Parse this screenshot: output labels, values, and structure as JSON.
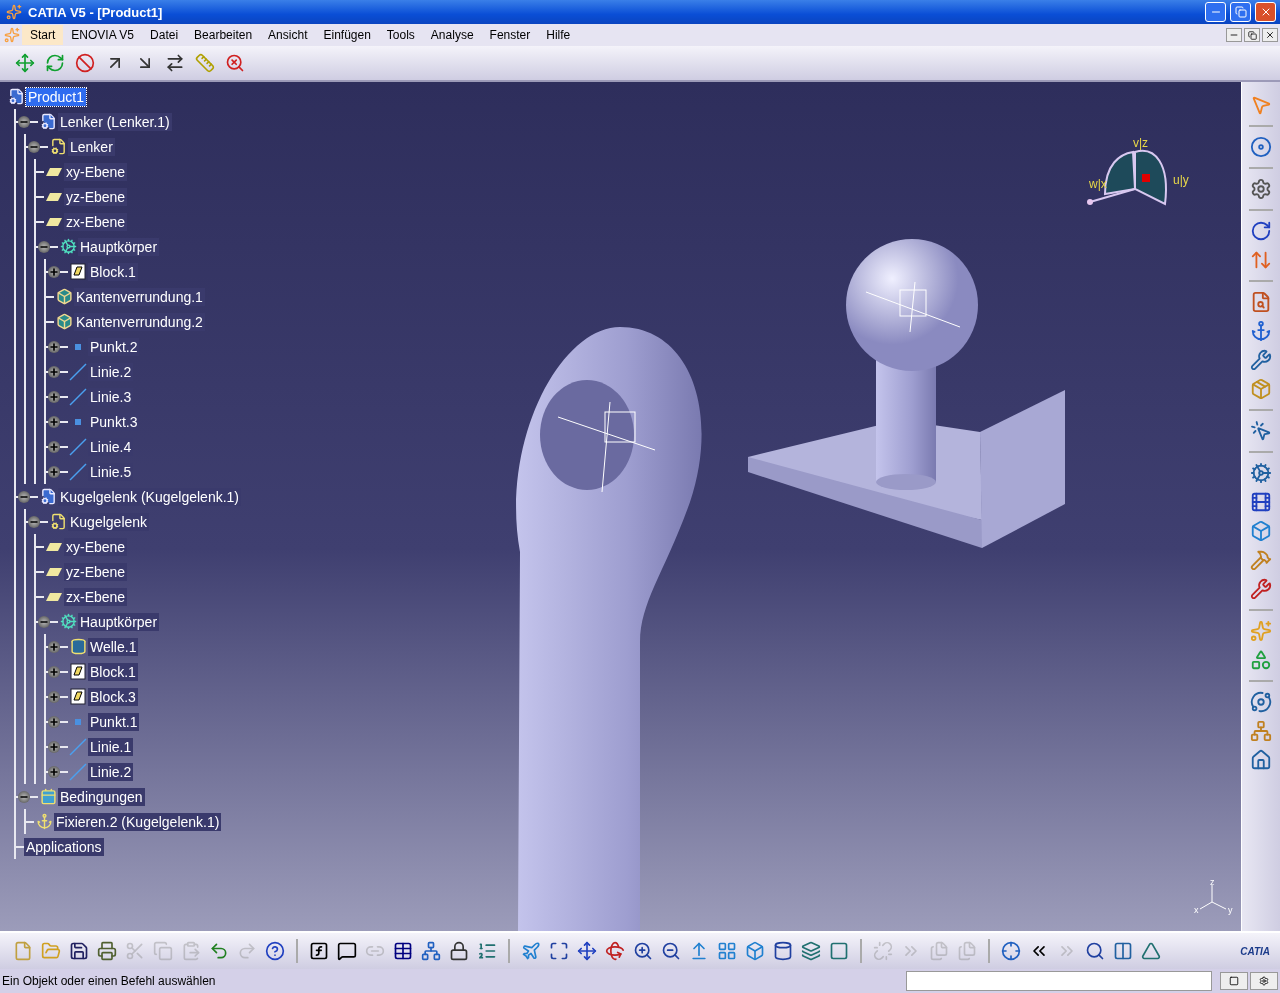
{
  "window": {
    "title": "CATIA V5 - [Product1]"
  },
  "menu": [
    {
      "label": "Start",
      "selected": true
    },
    {
      "label": "ENOVIA V5",
      "selected": false
    },
    {
      "label": "Datei",
      "selected": false
    },
    {
      "label": "Bearbeiten",
      "selected": false
    },
    {
      "label": "Ansicht",
      "selected": false
    },
    {
      "label": "Einfügen",
      "selected": false
    },
    {
      "label": "Tools",
      "selected": false
    },
    {
      "label": "Analyse",
      "selected": false
    },
    {
      "label": "Fenster",
      "selected": false
    },
    {
      "label": "Hilfe",
      "selected": false
    }
  ],
  "tree": [
    {
      "label": "Product1",
      "kind": "product",
      "selected": true,
      "children": [
        {
          "label": "Lenker (Lenker.1)",
          "kind": "instance",
          "selected": false,
          "expanded": true,
          "children": [
            {
              "label": "Lenker",
              "kind": "part",
              "selected": false,
              "expanded": true,
              "children": [
                {
                  "label": "xy-Ebene",
                  "kind": "plane",
                  "selected": false
                },
                {
                  "label": "yz-Ebene",
                  "kind": "plane",
                  "selected": false
                },
                {
                  "label": "zx-Ebene",
                  "kind": "plane",
                  "selected": false
                },
                {
                  "label": "Hauptkörper",
                  "kind": "body",
                  "selected": false,
                  "expanded": true,
                  "children": [
                    {
                      "label": "Block.1",
                      "kind": "block",
                      "selected": false,
                      "expanded": false
                    },
                    {
                      "label": "Kantenverrundung.1",
                      "kind": "fillet",
                      "selected": false
                    },
                    {
                      "label": "Kantenverrundung.2",
                      "kind": "fillet",
                      "selected": false
                    },
                    {
                      "label": "Punkt.2",
                      "kind": "point",
                      "selected": false,
                      "expanded": false
                    },
                    {
                      "label": "Linie.2",
                      "kind": "line",
                      "selected": false,
                      "expanded": false
                    },
                    {
                      "label": "Linie.3",
                      "kind": "line",
                      "selected": false,
                      "expanded": false
                    },
                    {
                      "label": "Punkt.3",
                      "kind": "point",
                      "selected": false,
                      "expanded": false
                    },
                    {
                      "label": "Linie.4",
                      "kind": "line",
                      "selected": false,
                      "expanded": false
                    },
                    {
                      "label": "Linie.5",
                      "kind": "line",
                      "selected": false,
                      "expanded": false
                    }
                  ]
                }
              ]
            }
          ]
        },
        {
          "label": "Kugelgelenk (Kugelgelenk.1)",
          "kind": "instance",
          "selected": false,
          "expanded": true,
          "children": [
            {
              "label": "Kugelgelenk",
              "kind": "part",
              "selected": false,
              "expanded": true,
              "children": [
                {
                  "label": "xy-Ebene",
                  "kind": "plane",
                  "selected": false
                },
                {
                  "label": "yz-Ebene",
                  "kind": "plane",
                  "selected": false
                },
                {
                  "label": "zx-Ebene",
                  "kind": "plane",
                  "selected": false
                },
                {
                  "label": "Hauptkörper",
                  "kind": "body",
                  "selected": false,
                  "expanded": true,
                  "children": [
                    {
                      "label": "Welle.1",
                      "kind": "shaft",
                      "selected": false,
                      "expanded": false
                    },
                    {
                      "label": "Block.1",
                      "kind": "block",
                      "selected": false,
                      "expanded": false
                    },
                    {
                      "label": "Block.3",
                      "kind": "block",
                      "selected": false,
                      "expanded": false
                    },
                    {
                      "label": "Punkt.1",
                      "kind": "point",
                      "selected": false,
                      "expanded": false
                    },
                    {
                      "label": "Linie.1",
                      "kind": "line",
                      "selected": false,
                      "expanded": false
                    },
                    {
                      "label": "Linie.2",
                      "kind": "line",
                      "selected": false,
                      "expanded": false
                    }
                  ]
                }
              ]
            }
          ]
        },
        {
          "label": "Bedingungen",
          "kind": "constraints",
          "selected": false,
          "expanded": true,
          "children": [
            {
              "label": "Fixieren.2 (Kugelgelenk.1)",
              "kind": "fix",
              "selected": false
            }
          ]
        },
        {
          "label": "Applications",
          "kind": "apps",
          "selected": false
        }
      ]
    }
  ],
  "compass": {
    "labels": [
      "v|z",
      "u|y",
      "w|x"
    ]
  },
  "triad": {
    "labels": [
      "z",
      "y",
      "x"
    ]
  },
  "logo": "CATIA",
  "status_bar": {
    "text": "Ein Objekt oder einen Befehl auswählen"
  }
}
